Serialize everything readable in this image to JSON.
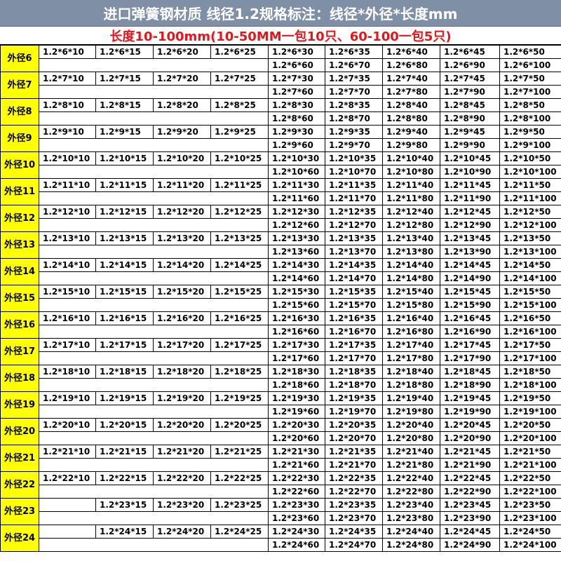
{
  "title": "进口弹簧钢材质  线径1.2规格标注：线径*外径*长度mm",
  "subtitle": "长度10-100mm(10-50MM一包10只、60-100一包5只)",
  "rows": [
    {
      "label": "外径6",
      "top": [
        "1.2*6*10",
        "1.2*6*15",
        "1.2*6*20",
        "1.2*6*25",
        "1.2*6*30",
        "1.2*6*35",
        "1.2*6*40",
        "1.2*6*45",
        "1.2*6*50"
      ],
      "bottom": [
        "1.2*6*60",
        "1.2*6*70",
        "1.2*6*80",
        "1.2*6*90",
        "1.2*6*100"
      ]
    },
    {
      "label": "外径7",
      "top": [
        "1.2*7*10",
        "1.2*7*15",
        "1.2*7*20",
        "1.2*7*25",
        "1.2*7*30",
        "1.2*7*35",
        "1.2*7*40",
        "1.2*7*45",
        "1.2*7*50"
      ],
      "bottom": [
        "1.2*7*60",
        "1.2*7*70",
        "1.2*7*80",
        "1.2*7*90",
        "1.2*7*100"
      ]
    },
    {
      "label": "外径8",
      "top": [
        "1.2*8*10",
        "1.2*8*15",
        "1.2*8*20",
        "1.2*8*25",
        "1.2*8*30",
        "1.2*8*35",
        "1.2*8*40",
        "1.2*8*45",
        "1.2*8*50"
      ],
      "bottom": [
        "1.2*8*60",
        "1.2*8*70",
        "1.2*8*80",
        "1.2*8*90",
        "1.2*8*100"
      ]
    },
    {
      "label": "外径9",
      "top": [
        "1.2*9*10",
        "1.2*9*15",
        "1.2*9*20",
        "1.2*9*25",
        "1.2*9*30",
        "1.2*9*35",
        "1.2*9*40",
        "1.2*9*45",
        "1.2*9*50"
      ],
      "bottom": [
        "1.2*9*60",
        "1.2*9*70",
        "1.2*9*80",
        "1.2*9*90",
        "1.2*9*100"
      ]
    },
    {
      "label": "外径10",
      "top": [
        "1.2*10*10",
        "1.2*10*15",
        "1.2*10*20",
        "1.2*10*25",
        "1.2*10*30",
        "1.2*10*35",
        "1.2*10*40",
        "1.2*10*45",
        "1.2*10*50"
      ],
      "bottom": [
        "1.2*10*60",
        "1.2*10*70",
        "1.2*10*80",
        "1.2*10*90",
        "1.2*10*100"
      ]
    },
    {
      "label": "外径11",
      "top": [
        "1.2*11*10",
        "1.2*11*15",
        "1.2*11*20",
        "1.2*11*25",
        "1.2*11*30",
        "1.2*11*35",
        "1.2*11*40",
        "1.2*11*45",
        "1.2*11*50"
      ],
      "bottom": [
        "1.2*11*60",
        "1.2*11*70",
        "1.2*11*80",
        "1.2*11*90",
        "1.2*11*100"
      ]
    },
    {
      "label": "外径12",
      "top": [
        "1.2*12*10",
        "1.2*12*15",
        "1.2*12*20",
        "1.2*12*25",
        "1.2*12*30",
        "1.2*12*35",
        "1.2*12*40",
        "1.2*12*45",
        "1.2*12*50"
      ],
      "bottom": [
        "1.2*12*60",
        "1.2*12*70",
        "1.2*12*80",
        "1.2*12*90",
        "1.2*12*100"
      ]
    },
    {
      "label": "外径13",
      "top": [
        "1.2*13*10",
        "1.2*13*15",
        "1.2*13*20",
        "1.2*13*25",
        "1.2*13*30",
        "1.2*13*35",
        "1.2*13*40",
        "1.2*13*45",
        "1.2*13*50"
      ],
      "bottom": [
        "1.2*13*60",
        "1.2*13*70",
        "1.2*13*80",
        "1.2*13*90",
        "1.2*13*100"
      ]
    },
    {
      "label": "外径14",
      "top": [
        "1.2*14*10",
        "1.2*14*15",
        "1.2*14*20",
        "1.2*14*25",
        "1.2*14*30",
        "1.2*14*35",
        "1.2*14*40",
        "1.2*14*45",
        "1.2*14*50"
      ],
      "bottom": [
        "1.2*14*60",
        "1.2*14*70",
        "1.2*14*80",
        "1.2*14*90",
        "1.2*14*100"
      ]
    },
    {
      "label": "外径15",
      "top": [
        "1.2*15*10",
        "1.2*15*15",
        "1.2*15*20",
        "1.2*15*25",
        "1.2*15*30",
        "1.2*15*35",
        "1.2*15*40",
        "1.2*15*45",
        "1.2*15*50"
      ],
      "bottom": [
        "1.2*15*60",
        "1.2*15*70",
        "1.2*15*80",
        "1.2*15*90",
        "1.2*15*100"
      ]
    },
    {
      "label": "外径16",
      "top": [
        "1.2*16*10",
        "1.2*16*15",
        "1.2*16*20",
        "1.2*16*25",
        "1.2*16*30",
        "1.2*16*35",
        "1.2*16*40",
        "1.2*16*45",
        "1.2*16*50"
      ],
      "bottom": [
        "1.2*16*60",
        "1.2*16*70",
        "1.2*16*80",
        "1.2*16*90",
        "1.2*16*100"
      ]
    },
    {
      "label": "外径17",
      "top": [
        "1.2*17*10",
        "1.2*17*15",
        "1.2*17*20",
        "1.2*17*25",
        "1.2*17*30",
        "1.2*17*35",
        "1.2*17*40",
        "1.2*17*45",
        "1.2*17*50"
      ],
      "bottom": [
        "1.2*17*60",
        "1.2*17*70",
        "1.2*17*80",
        "1.2*17*90",
        "1.2*17*100"
      ]
    },
    {
      "label": "外径18",
      "top": [
        "1.2*18*10",
        "1.2*18*15",
        "1.2*18*20",
        "1.2*18*25",
        "1.2*18*30",
        "1.2*18*35",
        "1.2*18*40",
        "1.2*18*45",
        "1.2*18*50"
      ],
      "bottom": [
        "1.2*18*60",
        "1.2*18*70",
        "1.2*18*80",
        "1.2*18*90",
        "1.2*18*100"
      ]
    },
    {
      "label": "外径19",
      "top": [
        "1.2*19*10",
        "1.2*19*15",
        "1.2*19*20",
        "1.2*19*25",
        "1.2*19*30",
        "1.2*19*35",
        "1.2*19*40",
        "1.2*19*45",
        "1.2*19*50"
      ],
      "bottom": [
        "1.2*19*60",
        "1.2*19*70",
        "1.2*19*80",
        "1.2*19*90",
        "1.2*19*100"
      ]
    },
    {
      "label": "外径20",
      "top": [
        "1.2*20*10",
        "1.2*20*15",
        "1.2*20*20",
        "1.2*20*25",
        "1.2*20*30",
        "1.2*20*35",
        "1.2*20*40",
        "1.2*20*45",
        "1.2*20*50"
      ],
      "bottom": [
        "1.2*20*60",
        "1.2*20*70",
        "1.2*20*80",
        "1.2*20*90",
        "1.2*20*100"
      ]
    },
    {
      "label": "外径21",
      "top": [
        "1.2*21*10",
        "1.2*21*15",
        "1.2*21*20",
        "1.2*21*25",
        "1.2*21*30",
        "1.2*21*35",
        "1.2*21*40",
        "1.2*21*45",
        "1.2*21*50"
      ],
      "bottom": [
        "1.2*21*60",
        "1.2*21*70",
        "1.2*21*80",
        "1.2*21*90",
        "1.2*21*100"
      ]
    },
    {
      "label": "外径22",
      "top": [
        "1.2*22*10",
        "1.2*22*15",
        "1.2*22*20",
        "1.2*22*25",
        "1.2*22*30",
        "1.2*22*35",
        "1.2*22*40",
        "1.2*22*45",
        "1.2*22*50"
      ],
      "bottom": [
        "1.2*22*60",
        "1.2*22*70",
        "1.2*22*80",
        "1.2*22*90",
        "1.2*22*100"
      ]
    },
    {
      "label": "外径23",
      "top": [
        "",
        "1.2*23*15",
        "1.2*23*20",
        "1.2*23*25",
        "1.2*23*30",
        "1.2*23*35",
        "1.2*23*40",
        "1.2*23*45",
        "1.2*23*50"
      ],
      "bottom": [
        "1.2*23*60",
        "1.2*23*70",
        "1.2*23*80",
        "1.2*23*90",
        "1.2*23*100"
      ]
    },
    {
      "label": "外径24",
      "top": [
        "",
        "1.2*24*15",
        "1.2*24*20",
        "1.2*24*25",
        "1.2*24*30",
        "1.2*24*35",
        "1.2*24*40",
        "1.2*24*45",
        "1.2*24*50"
      ],
      "bottom": [
        "1.2*24*60",
        "1.2*24*70",
        "1.2*24*80",
        "1.2*24*90",
        "1.2*24*100"
      ]
    }
  ]
}
